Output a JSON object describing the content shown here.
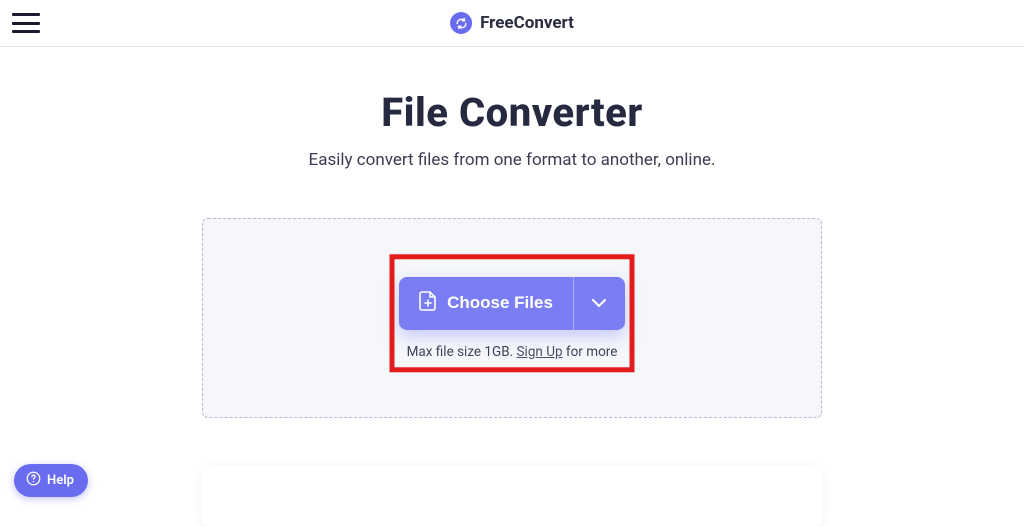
{
  "header": {
    "brand_free": "Free",
    "brand_convert": "Convert"
  },
  "hero": {
    "title": "File Converter",
    "subtitle": "Easily convert files from one format to another, online."
  },
  "upload": {
    "choose_label": "Choose Files",
    "max_prefix": "Max file size 1GB. ",
    "signup_label": "Sign Up",
    "max_suffix": " for more"
  },
  "help": {
    "label": "Help"
  }
}
